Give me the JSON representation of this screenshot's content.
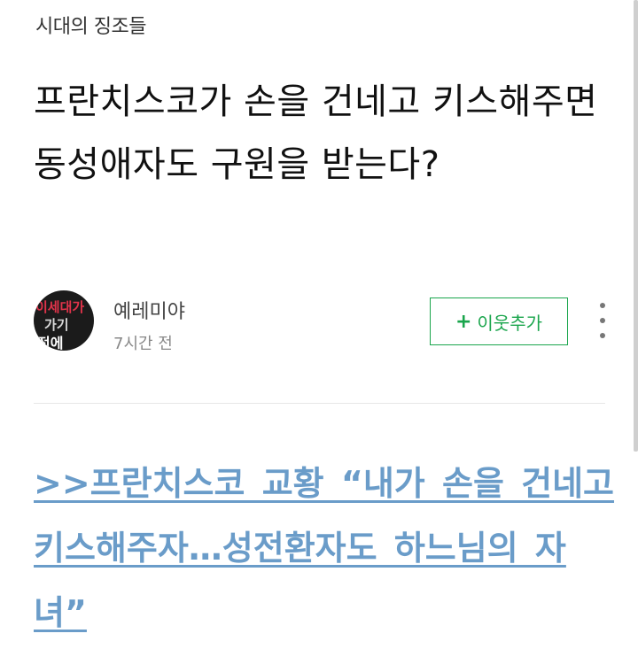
{
  "post": {
    "category": "시대의 징조들",
    "title": "프란치스코가 손을 건네고 키스해주면 동성애자도 구원을 받는다?",
    "author": {
      "name": "예레미야",
      "time": "7시간 전",
      "avatar_text": [
        "이세대가",
        "가기",
        "전에"
      ]
    },
    "follow_button": {
      "icon": "+",
      "label": "이웃추가"
    },
    "more_icon": "vertical-ellipsis-icon",
    "link_text": ">>프란치스코 교황 “내가 손을 건네고 키스해주자…성전환자도 하느님의 자녀”"
  },
  "colors": {
    "follow_green": "#1aa54c",
    "link_blue": "#6a9cc9"
  }
}
